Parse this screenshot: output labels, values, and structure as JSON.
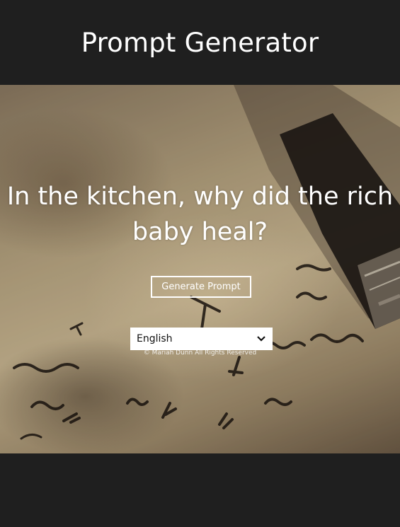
{
  "header": {
    "title": "Prompt Generator"
  },
  "main": {
    "prompt": "In the kitchen, why did the rich baby heal?",
    "generate_label": "Generate Prompt",
    "language": {
      "selected": "English",
      "icon": "chevron-down-icon"
    },
    "copyright": "© Mariah Dunn All Rights Reserved"
  },
  "colors": {
    "background": "#1f1f1f",
    "text": "#ffffff",
    "select_bg": "#ffffff"
  }
}
